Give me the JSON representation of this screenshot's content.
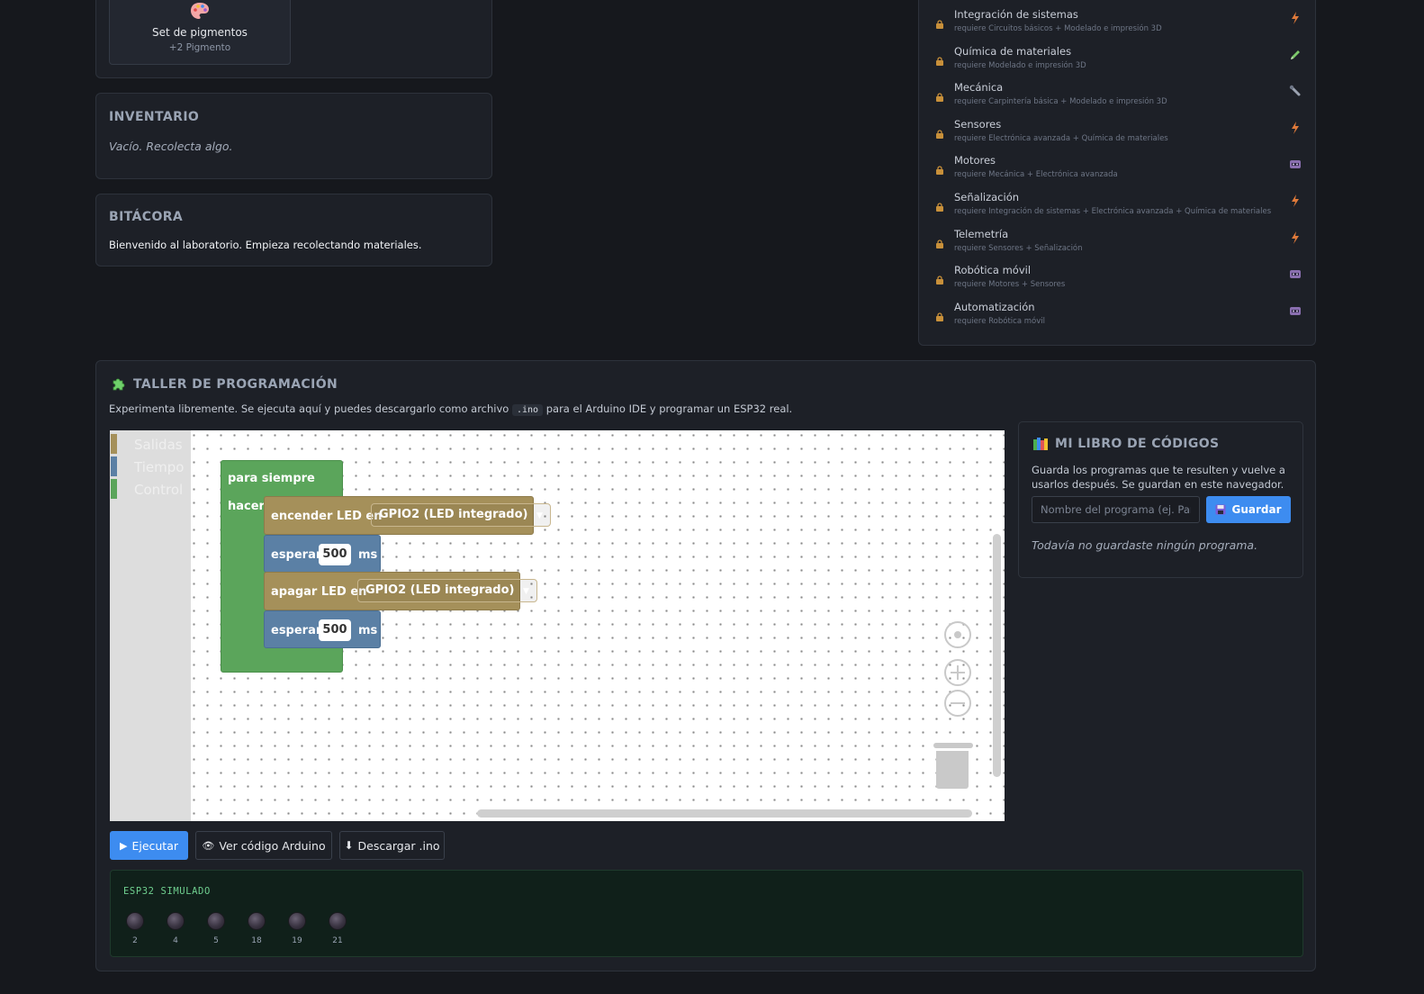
{
  "recipe": {
    "name": "Set de pigmentos",
    "reward": "+2 Pigmento",
    "icon": "palette-icon"
  },
  "inventory": {
    "title": "INVENTARIO",
    "empty_text": "Vacío. Recolecta algo."
  },
  "log": {
    "title": "BITÁCORA",
    "message": "Bienvenido al laboratorio. Empieza recolectando materiales."
  },
  "tech_tree": [
    {
      "name": "Integración de sistemas",
      "req": "requiere Circuitos básicos + Modelado e impresión 3D",
      "icon": "lightning-icon"
    },
    {
      "name": "Química de materiales",
      "req": "requiere Modelado e impresión 3D",
      "icon": "pencil-icon"
    },
    {
      "name": "Mecánica",
      "req": "requiere Carpintería básica + Modelado e impresión 3D",
      "icon": "wrench-icon"
    },
    {
      "name": "Sensores",
      "req": "requiere Electrónica avanzada + Química de materiales",
      "icon": "lightning-icon"
    },
    {
      "name": "Motores",
      "req": "requiere Mecánica + Electrónica avanzada",
      "icon": "robot-icon"
    },
    {
      "name": "Señalización",
      "req": "requiere Integración de sistemas + Electrónica avanzada + Química de materiales",
      "icon": "lightning-icon"
    },
    {
      "name": "Telemetría",
      "req": "requiere Sensores + Señalización",
      "icon": "lightning-icon"
    },
    {
      "name": "Robótica móvil",
      "req": "requiere Motores + Sensores",
      "icon": "robot-icon"
    },
    {
      "name": "Automatización",
      "req": "requiere Robótica móvil",
      "icon": "robot-icon"
    }
  ],
  "workshop": {
    "title": "TALLER DE PROGRAMACIÓN",
    "desc_before": "Experimenta libremente. Se ejecuta aquí y puedes descargarlo como archivo ",
    "desc_code": ".ino",
    "desc_after": " para el Arduino IDE y programar un ESP32 real."
  },
  "toolbox": [
    {
      "label": "Salidas",
      "color": "#a5905a"
    },
    {
      "label": "Tiempo",
      "color": "#5b80a5"
    },
    {
      "label": "Control",
      "color": "#5ba55b"
    }
  ],
  "blocks": {
    "forever": "para siempre",
    "do": "hacer",
    "led_on": "encender LED en",
    "led_off": "apagar LED en",
    "pin_option": "GPIO2 (LED integrado)",
    "wait": "esperar",
    "ms": "ms",
    "wait1_value": "500",
    "wait2_value": "500"
  },
  "codebook": {
    "title": "MI LIBRO DE CÓDIGOS",
    "desc": "Guarda los programas que te resulten y vuelve a usarlos después. Se guardan en este navegador.",
    "input_placeholder": "Nombre del programa (ej. Parpadeo)",
    "save_label": "Guardar",
    "empty_text": "Todavía no guardaste ningún programa."
  },
  "buttons": {
    "run": "Ejecutar",
    "view": "Ver código Arduino",
    "download": "Descargar .ino"
  },
  "esp32": {
    "title": "ESP32 SIMULADO",
    "pins": [
      "2",
      "4",
      "5",
      "18",
      "19",
      "21"
    ]
  },
  "colors": {
    "accent": "#3d8cf0",
    "block_green": "#5ba55b",
    "block_olive": "#a5905a",
    "block_blue": "#5b80a5"
  }
}
